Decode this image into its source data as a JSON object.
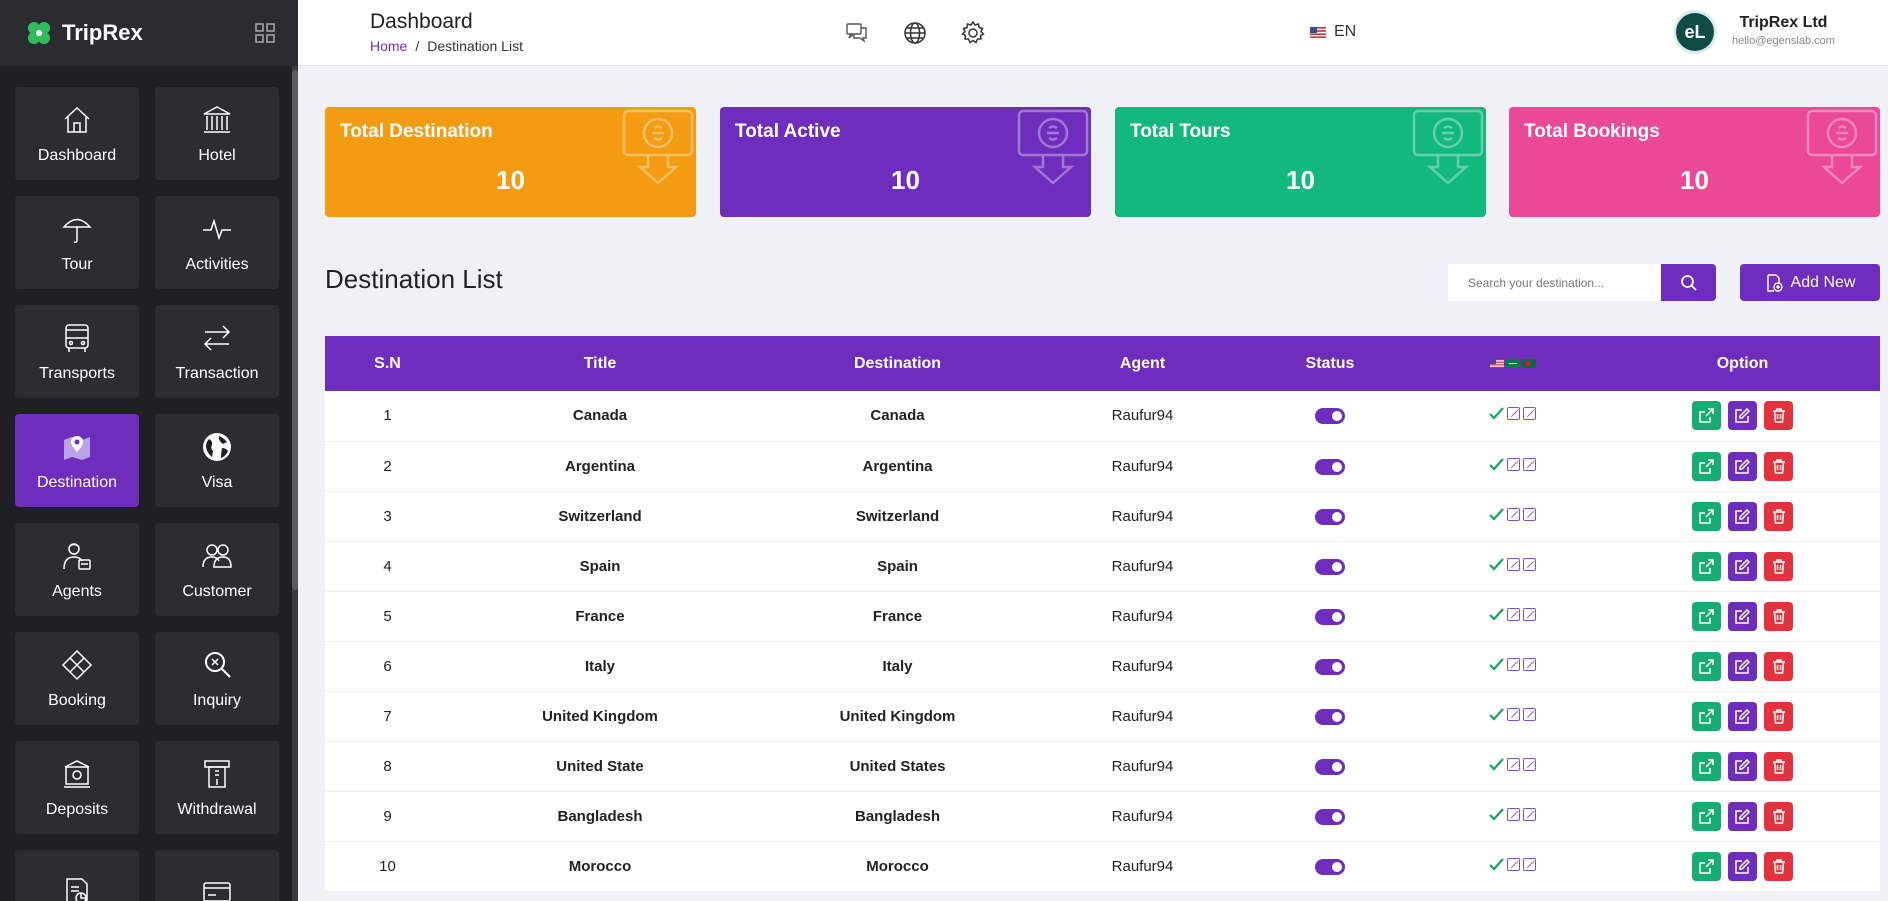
{
  "brand": {
    "name": "TripRex"
  },
  "colors": {
    "primary": "#6f2dbd",
    "orange": "#f39c12",
    "green": "#13b87c",
    "pink": "#eb4895",
    "sidebar": "#1f2023"
  },
  "sidebar": {
    "items": [
      {
        "label": "Dashboard",
        "icon": "home-icon"
      },
      {
        "label": "Hotel",
        "icon": "hotel-icon"
      },
      {
        "label": "Tour",
        "icon": "umbrella-icon"
      },
      {
        "label": "Activities",
        "icon": "activity-icon"
      },
      {
        "label": "Transports",
        "icon": "bus-icon"
      },
      {
        "label": "Transaction",
        "icon": "transfer-icon"
      },
      {
        "label": "Destination",
        "icon": "map-icon",
        "active": true
      },
      {
        "label": "Visa",
        "icon": "globe-icon"
      },
      {
        "label": "Agents",
        "icon": "agent-icon"
      },
      {
        "label": "Customer",
        "icon": "users-icon"
      },
      {
        "label": "Booking",
        "icon": "diamond-icon"
      },
      {
        "label": "Inquiry",
        "icon": "magnify-icon"
      },
      {
        "label": "Deposits",
        "icon": "deposit-icon"
      },
      {
        "label": "Withdrawal",
        "icon": "atm-icon"
      },
      {
        "label": "",
        "icon": "report-icon"
      },
      {
        "label": "",
        "icon": "card-icon"
      }
    ]
  },
  "header": {
    "title": "Dashboard",
    "breadcrumb": {
      "home": "Home",
      "separator": "/",
      "current": "Destination List"
    },
    "language": "EN",
    "company": "TripRex Ltd",
    "email": "hello@egenslab.com",
    "avatar_initials": "eL"
  },
  "stats": [
    {
      "label": "Total Destination",
      "value": "10",
      "color": "#f39c12"
    },
    {
      "label": "Total Active",
      "value": "10",
      "color": "#6f2dbd"
    },
    {
      "label": "Total Tours",
      "value": "10",
      "color": "#13b87c"
    },
    {
      "label": "Total Bookings",
      "value": "10",
      "color": "#eb4895"
    }
  ],
  "list": {
    "title": "Destination List",
    "search_placeholder": "Search your destination...",
    "add_label": "Add New",
    "columns": {
      "sn": "S.N",
      "title": "Title",
      "destination": "Destination",
      "agent": "Agent",
      "status": "Status",
      "option": "Option"
    },
    "rows": [
      {
        "sn": "1",
        "title": "Canada",
        "destination": "Canada",
        "agent": "Raufur94",
        "status": "on"
      },
      {
        "sn": "2",
        "title": "Argentina",
        "destination": "Argentina",
        "agent": "Raufur94",
        "status": "on"
      },
      {
        "sn": "3",
        "title": "Switzerland",
        "destination": "Switzerland",
        "agent": "Raufur94",
        "status": "on"
      },
      {
        "sn": "4",
        "title": "Spain",
        "destination": "Spain",
        "agent": "Raufur94",
        "status": "on"
      },
      {
        "sn": "5",
        "title": "France",
        "destination": "France",
        "agent": "Raufur94",
        "status": "on"
      },
      {
        "sn": "6",
        "title": "Italy",
        "destination": "Italy",
        "agent": "Raufur94",
        "status": "on"
      },
      {
        "sn": "7",
        "title": "United Kingdom",
        "destination": "United Kingdom",
        "agent": "Raufur94",
        "status": "on"
      },
      {
        "sn": "8",
        "title": "United State",
        "destination": "United States",
        "agent": "Raufur94",
        "status": "on"
      },
      {
        "sn": "9",
        "title": "Bangladesh",
        "destination": "Bangladesh",
        "agent": "Raufur94",
        "status": "on"
      },
      {
        "sn": "10",
        "title": "Morocco",
        "destination": "Morocco",
        "agent": "Raufur94",
        "status": "on"
      }
    ]
  }
}
